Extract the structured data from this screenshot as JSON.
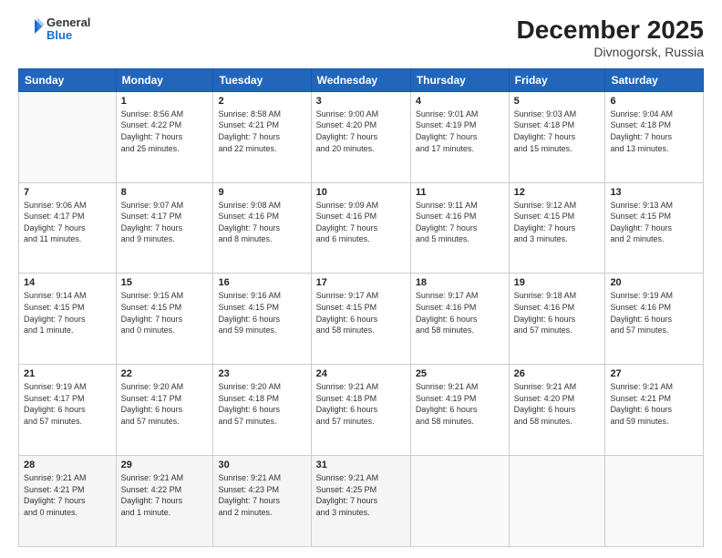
{
  "header": {
    "logo_general": "General",
    "logo_blue": "Blue",
    "month_title": "December 2025",
    "subtitle": "Divnogorsk, Russia"
  },
  "days_of_week": [
    "Sunday",
    "Monday",
    "Tuesday",
    "Wednesday",
    "Thursday",
    "Friday",
    "Saturday"
  ],
  "weeks": [
    [
      {
        "day": "",
        "info": ""
      },
      {
        "day": "1",
        "info": "Sunrise: 8:56 AM\nSunset: 4:22 PM\nDaylight: 7 hours\nand 25 minutes."
      },
      {
        "day": "2",
        "info": "Sunrise: 8:58 AM\nSunset: 4:21 PM\nDaylight: 7 hours\nand 22 minutes."
      },
      {
        "day": "3",
        "info": "Sunrise: 9:00 AM\nSunset: 4:20 PM\nDaylight: 7 hours\nand 20 minutes."
      },
      {
        "day": "4",
        "info": "Sunrise: 9:01 AM\nSunset: 4:19 PM\nDaylight: 7 hours\nand 17 minutes."
      },
      {
        "day": "5",
        "info": "Sunrise: 9:03 AM\nSunset: 4:18 PM\nDaylight: 7 hours\nand 15 minutes."
      },
      {
        "day": "6",
        "info": "Sunrise: 9:04 AM\nSunset: 4:18 PM\nDaylight: 7 hours\nand 13 minutes."
      }
    ],
    [
      {
        "day": "7",
        "info": "Sunrise: 9:06 AM\nSunset: 4:17 PM\nDaylight: 7 hours\nand 11 minutes."
      },
      {
        "day": "8",
        "info": "Sunrise: 9:07 AM\nSunset: 4:17 PM\nDaylight: 7 hours\nand 9 minutes."
      },
      {
        "day": "9",
        "info": "Sunrise: 9:08 AM\nSunset: 4:16 PM\nDaylight: 7 hours\nand 8 minutes."
      },
      {
        "day": "10",
        "info": "Sunrise: 9:09 AM\nSunset: 4:16 PM\nDaylight: 7 hours\nand 6 minutes."
      },
      {
        "day": "11",
        "info": "Sunrise: 9:11 AM\nSunset: 4:16 PM\nDaylight: 7 hours\nand 5 minutes."
      },
      {
        "day": "12",
        "info": "Sunrise: 9:12 AM\nSunset: 4:15 PM\nDaylight: 7 hours\nand 3 minutes."
      },
      {
        "day": "13",
        "info": "Sunrise: 9:13 AM\nSunset: 4:15 PM\nDaylight: 7 hours\nand 2 minutes."
      }
    ],
    [
      {
        "day": "14",
        "info": "Sunrise: 9:14 AM\nSunset: 4:15 PM\nDaylight: 7 hours\nand 1 minute."
      },
      {
        "day": "15",
        "info": "Sunrise: 9:15 AM\nSunset: 4:15 PM\nDaylight: 7 hours\nand 0 minutes."
      },
      {
        "day": "16",
        "info": "Sunrise: 9:16 AM\nSunset: 4:15 PM\nDaylight: 6 hours\nand 59 minutes."
      },
      {
        "day": "17",
        "info": "Sunrise: 9:17 AM\nSunset: 4:15 PM\nDaylight: 6 hours\nand 58 minutes."
      },
      {
        "day": "18",
        "info": "Sunrise: 9:17 AM\nSunset: 4:16 PM\nDaylight: 6 hours\nand 58 minutes."
      },
      {
        "day": "19",
        "info": "Sunrise: 9:18 AM\nSunset: 4:16 PM\nDaylight: 6 hours\nand 57 minutes."
      },
      {
        "day": "20",
        "info": "Sunrise: 9:19 AM\nSunset: 4:16 PM\nDaylight: 6 hours\nand 57 minutes."
      }
    ],
    [
      {
        "day": "21",
        "info": "Sunrise: 9:19 AM\nSunset: 4:17 PM\nDaylight: 6 hours\nand 57 minutes."
      },
      {
        "day": "22",
        "info": "Sunrise: 9:20 AM\nSunset: 4:17 PM\nDaylight: 6 hours\nand 57 minutes."
      },
      {
        "day": "23",
        "info": "Sunrise: 9:20 AM\nSunset: 4:18 PM\nDaylight: 6 hours\nand 57 minutes."
      },
      {
        "day": "24",
        "info": "Sunrise: 9:21 AM\nSunset: 4:18 PM\nDaylight: 6 hours\nand 57 minutes."
      },
      {
        "day": "25",
        "info": "Sunrise: 9:21 AM\nSunset: 4:19 PM\nDaylight: 6 hours\nand 58 minutes."
      },
      {
        "day": "26",
        "info": "Sunrise: 9:21 AM\nSunset: 4:20 PM\nDaylight: 6 hours\nand 58 minutes."
      },
      {
        "day": "27",
        "info": "Sunrise: 9:21 AM\nSunset: 4:21 PM\nDaylight: 6 hours\nand 59 minutes."
      }
    ],
    [
      {
        "day": "28",
        "info": "Sunrise: 9:21 AM\nSunset: 4:21 PM\nDaylight: 7 hours\nand 0 minutes."
      },
      {
        "day": "29",
        "info": "Sunrise: 9:21 AM\nSunset: 4:22 PM\nDaylight: 7 hours\nand 1 minute."
      },
      {
        "day": "30",
        "info": "Sunrise: 9:21 AM\nSunset: 4:23 PM\nDaylight: 7 hours\nand 2 minutes."
      },
      {
        "day": "31",
        "info": "Sunrise: 9:21 AM\nSunset: 4:25 PM\nDaylight: 7 hours\nand 3 minutes."
      },
      {
        "day": "",
        "info": ""
      },
      {
        "day": "",
        "info": ""
      },
      {
        "day": "",
        "info": ""
      }
    ]
  ]
}
